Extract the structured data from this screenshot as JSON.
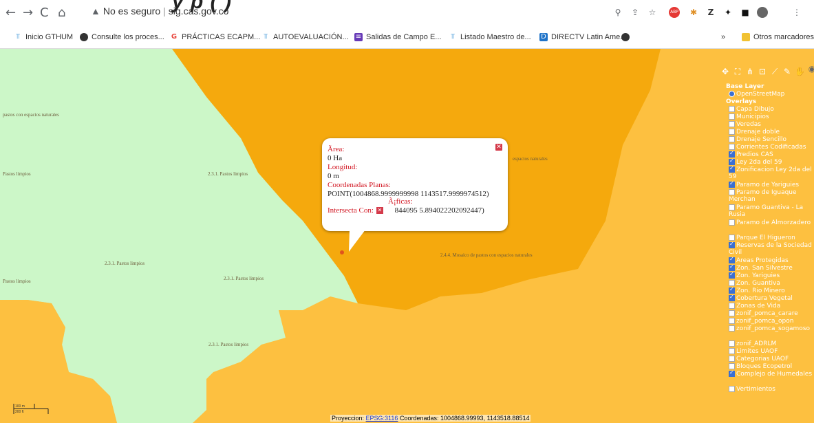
{
  "browser": {
    "partial_title": "y p ( )",
    "security_label": "No es seguro",
    "url": "sig.cas.gov.co",
    "extensions_label": "»",
    "other_bookmarks": "Otros marcadores"
  },
  "bookmarks": [
    {
      "label": "Inicio GTHUM",
      "icon": "link-icon",
      "color": "#2a8ad4"
    },
    {
      "label": "Consulte los proces...",
      "icon": "globe-icon",
      "color": "#333333"
    },
    {
      "label": "PRÁCTICAS ECAPM...",
      "icon": "google-icon",
      "color": "#e8453c"
    },
    {
      "label": "AUTOEVALUACIÓN...",
      "icon": "link-icon",
      "color": "#2a8ad4"
    },
    {
      "label": "Salidas de Campo E...",
      "icon": "forms-icon",
      "color": "#673ab7"
    },
    {
      "label": "Listado Maestro de...",
      "icon": "link-icon",
      "color": "#2a8ad4"
    },
    {
      "label": "DIRECTV Latin Ame...",
      "icon": "directv-icon",
      "color": "#1f73c8"
    },
    {
      "label": "",
      "icon": "globe-icon",
      "color": "#333333"
    }
  ],
  "map": {
    "colors": {
      "orange": "#fdc040",
      "dark_orange": "#f5a90d",
      "green": "#ccf7c8"
    },
    "labels": [
      "2.3.1. Pastos limpios",
      "2.3.1. Pastos limpios",
      "2.3.1. Pastos limpios",
      "2.3.1. Pastos limpios",
      "Pastos limpios",
      "Pastos limpios",
      "pastos con espacios naturales",
      "espacios naturales",
      "2.4.4. Mosaico de pastos con espacios naturales"
    ]
  },
  "popup": {
    "area_label": "Ãrea:",
    "area_value": "0 Ha",
    "length_label": "Longitud:",
    "length_value": "0 m",
    "planar_label": "Coordenadas Planas:",
    "planar_value": "POINT(1004868.9999999998 1143517.9999974512)",
    "geo_partial": "Ã¡ficas:",
    "intersect_label": "Intersecta Con:",
    "geo_value": "844095 5.894022202092447)"
  },
  "layers": {
    "base_title": "Base Layer",
    "base_option": "OpenStreetMap",
    "overlays_title": "Overlays",
    "items": [
      {
        "label": "Capa Dibujo",
        "checked": false
      },
      {
        "label": "Municipios",
        "checked": false
      },
      {
        "label": "Veredas",
        "checked": false
      },
      {
        "label": "Drenaje doble",
        "checked": false
      },
      {
        "label": "Drenaje Sencillo",
        "checked": false
      },
      {
        "label": "Corrientes Codificadas",
        "checked": false
      },
      {
        "label": "Predios CAS",
        "checked": true
      },
      {
        "label": "Ley 2da del 59",
        "checked": true
      },
      {
        "label": "Zonificacion Ley 2da del 59",
        "checked": true
      },
      {
        "label": "Paramo de Yariguies",
        "checked": true
      },
      {
        "label": "Paramo de Iguaque Merchan",
        "checked": false
      },
      {
        "label": "Paramo Guantiva - La Rusia",
        "checked": false
      },
      {
        "label": "Paramo de Almorzadero",
        "checked": false
      },
      {
        "label": "Parque El Higueron",
        "checked": false
      },
      {
        "label": "Reservas de la Sociedad Civil",
        "checked": true
      },
      {
        "label": "Areas Protegidas",
        "checked": true
      },
      {
        "label": "Zon. San Silvestre",
        "checked": true
      },
      {
        "label": "Zon. Yariguies",
        "checked": true
      },
      {
        "label": "Zon. Guantiva",
        "checked": false
      },
      {
        "label": "Zon. Rio Minero",
        "checked": true
      },
      {
        "label": "Cobertura Vegetal",
        "checked": true
      },
      {
        "label": "Zonas de Vida",
        "checked": false
      },
      {
        "label": "zonif_pomca_carare",
        "checked": false
      },
      {
        "label": "zonif_pomca_opon",
        "checked": false
      },
      {
        "label": "zonif_pomca_sogamoso",
        "checked": false
      },
      {
        "label": "zonif_ADRLM",
        "checked": false
      },
      {
        "label": "Limites UAOF",
        "checked": false
      },
      {
        "label": "Categorias UAOF",
        "checked": false
      },
      {
        "label": "Bloques Ecopetrol",
        "checked": false
      },
      {
        "label": "Complejo de Humedales",
        "checked": true
      },
      {
        "label": "Vertimientos",
        "checked": false
      }
    ]
  },
  "status": {
    "projection_label": "Proyeccion:",
    "projection_code": "EPSG:3116",
    "coords_label": "Coordenadas:",
    "coords_value": "1004868.99993, 1143518.88514"
  },
  "scale": {
    "top": "100 m",
    "bottom": "200 ft"
  }
}
